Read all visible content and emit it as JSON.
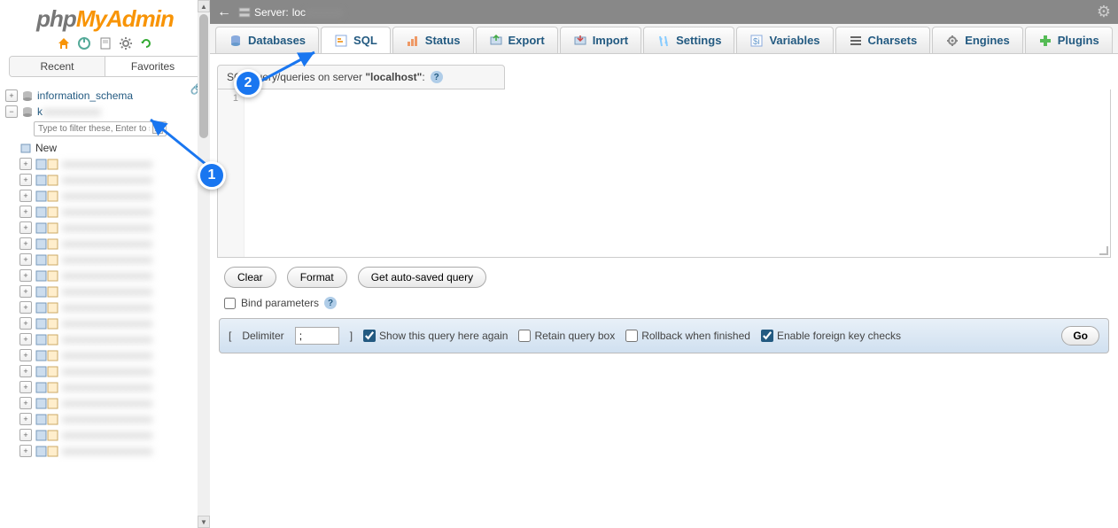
{
  "logo": {
    "php": "php",
    "myadmin": "MyAdmin"
  },
  "sidebar": {
    "recent": "Recent",
    "favorites": "Favorites",
    "filter_placeholder": "Type to filter these, Enter to search",
    "filter_clear": "X",
    "link_icon": "🔗",
    "db1": "information_schema",
    "db2": "k",
    "new_label": "New",
    "tables": [
      "",
      "",
      "",
      "",
      "",
      "",
      "",
      "",
      "",
      "",
      "",
      "",
      "",
      "",
      "",
      "",
      "",
      "",
      ""
    ]
  },
  "topbar": {
    "back": "←",
    "server_prefix": "Server:",
    "server_name": "loc",
    "gear": "⚙"
  },
  "tabs": [
    {
      "label": "Databases",
      "icon": "db"
    },
    {
      "label": "SQL",
      "icon": "sql"
    },
    {
      "label": "Status",
      "icon": "status"
    },
    {
      "label": "Export",
      "icon": "export"
    },
    {
      "label": "Import",
      "icon": "import"
    },
    {
      "label": "Settings",
      "icon": "settings"
    },
    {
      "label": "Variables",
      "icon": "vars"
    },
    {
      "label": "Charsets",
      "icon": "charsets"
    },
    {
      "label": "Engines",
      "icon": "engines"
    },
    {
      "label": "Plugins",
      "icon": "plugins"
    }
  ],
  "sql": {
    "header_pre": "SQL query/queries on server",
    "header_host": "\"localhost\"",
    "header_suffix": ":",
    "help": "?",
    "line1": "1",
    "clear": "Clear",
    "format": "Format",
    "get_autosaved": "Get auto-saved query",
    "bind_params": "Bind parameters",
    "delimiter_label": "Delimiter",
    "delimiter_value": ";",
    "show_again": "Show this query here again",
    "retain": "Retain query box",
    "rollback": "Rollback when finished",
    "fk": "Enable foreign key checks",
    "go": "Go",
    "bracket_open": "[",
    "bracket_close": "]"
  },
  "anno": {
    "one": "1",
    "two": "2"
  }
}
